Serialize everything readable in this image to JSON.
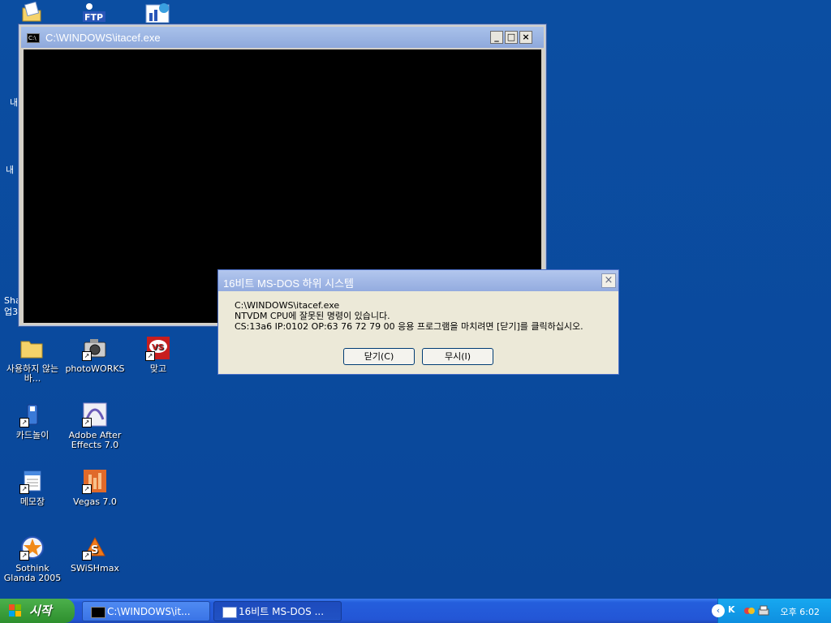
{
  "desktop": {
    "icons": [
      {
        "label": "사용하지 않는 바..."
      },
      {
        "label": "photoWORKS"
      },
      {
        "label": "맞고"
      },
      {
        "label": "카드놀이"
      },
      {
        "label": "Adobe After Effects 7.0"
      },
      {
        "label": "메모장"
      },
      {
        "label": "Vegas 7.0"
      },
      {
        "label": "Sothink Glanda 2005"
      },
      {
        "label": "SWiSHmax"
      }
    ],
    "partial_labels": [
      "내",
      "내",
      "Sha",
      "업3"
    ]
  },
  "console": {
    "title": "C:\\WINDOWS\\itacef.exe",
    "icon": "cmd-icon",
    "min_label": "_",
    "max_label": "□",
    "close_label": "×"
  },
  "dialog": {
    "title": "16비트 MS-DOS 하위 시스템",
    "close_label": "×",
    "lines": [
      "C:\\WINDOWS\\itacef.exe",
      "NTVDM CPU에 잘못된 명령이 있습니다.",
      "CS:13a6 IP:0102 OP:63 76 72 79 00 응용 프로그램을 마치려면 [닫기]를 클릭하십시오."
    ],
    "close_button": "닫기(C)",
    "ignore_button": "무시(I)"
  },
  "taskbar": {
    "start_label": "시작",
    "tasks": [
      {
        "label": "C:\\WINDOWS\\it...",
        "icon": "cmd-icon"
      },
      {
        "label": "16비트 MS-DOS ...",
        "icon": "window-icon"
      }
    ],
    "clock": "오후 6:02"
  },
  "colors": {
    "desktop": "#0b4ea2",
    "taskbar": "#245edc",
    "start": "#3a9f3a",
    "tray": "#0e8fe0"
  }
}
